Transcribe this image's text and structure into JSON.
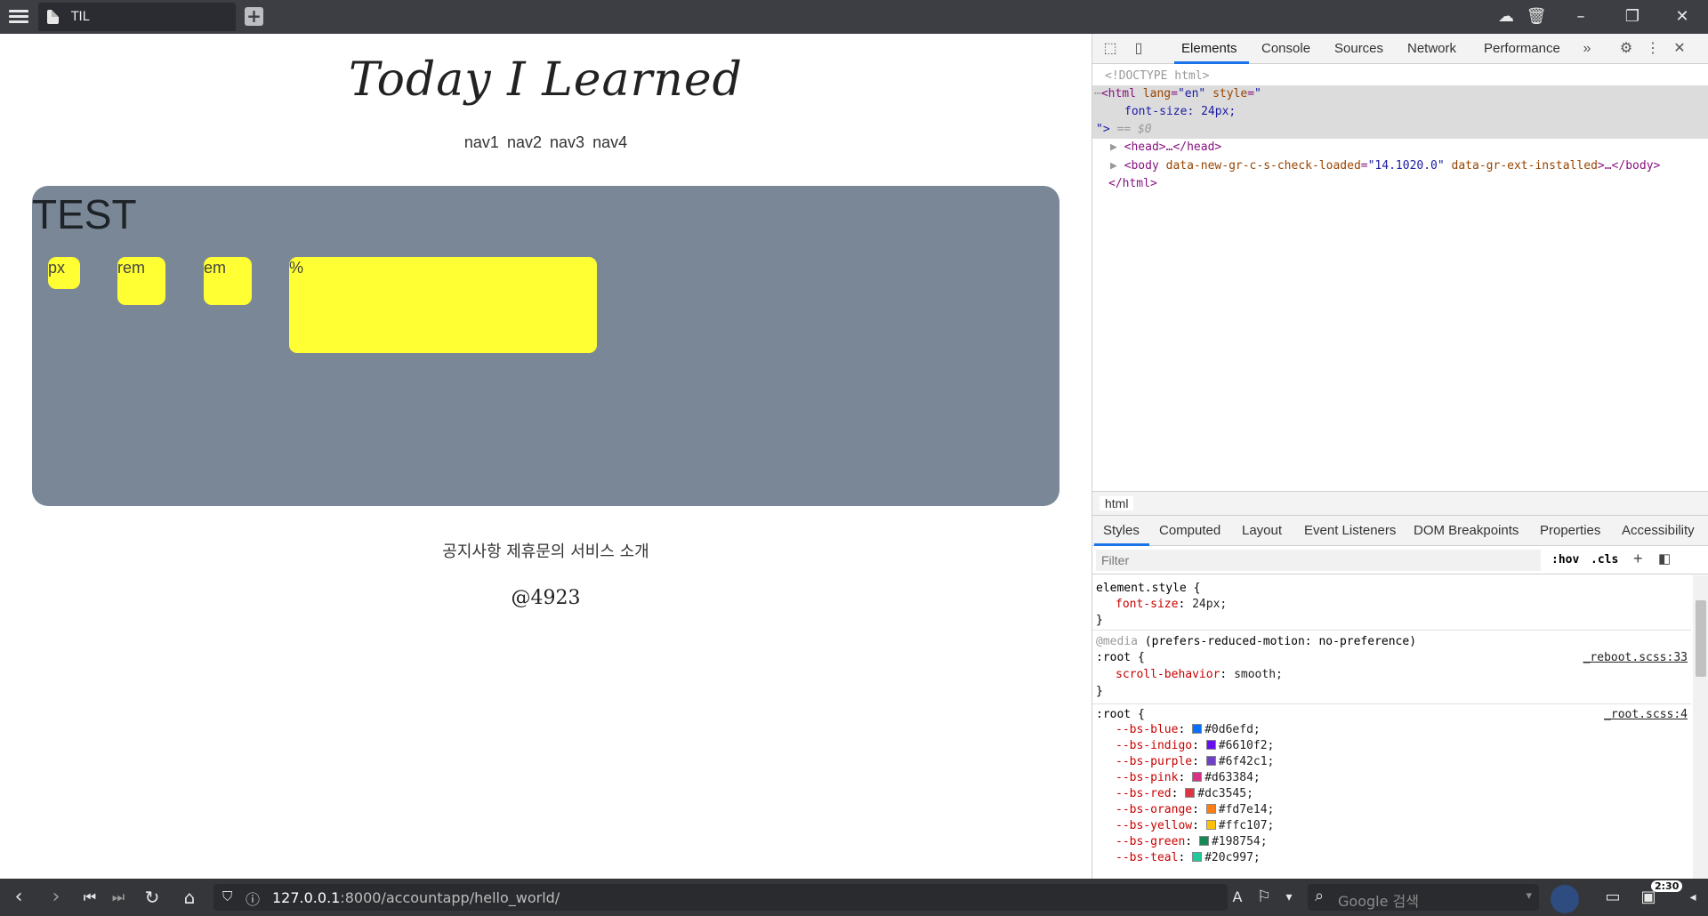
{
  "browser": {
    "tab_title": "TIL",
    "url_host": "127.0.0.1",
    "url_rest": ":8000/accountapp/hello_world/",
    "search_placeholder": "Google 검색",
    "clock": "2:30"
  },
  "page": {
    "title": "Today I Learned",
    "nav": [
      "nav1",
      "nav2",
      "nav3",
      "nav4"
    ],
    "test_heading": "TEST",
    "boxes": [
      "px",
      "rem",
      "em",
      "%"
    ],
    "footer_links": "공지사항 제휴문의 서비스 소개",
    "footer_copy": "@4923"
  },
  "devtools": {
    "tabs": [
      "Elements",
      "Console",
      "Sources",
      "Network",
      "Performance"
    ],
    "elements": {
      "doctype": "<!DOCTYPE html>",
      "html_open_tag": "<html",
      "html_attr_lang": "lang",
      "html_lang_val": "\"en\"",
      "html_attr_style": "style",
      "html_style_val": "\"",
      "style_line": "font-size: 24px;",
      "style_close": "\">",
      "eq0": "== $0",
      "head": "<head>…</head>",
      "body_open": "<body",
      "body_attr1": "data-new-gr-c-s-check-loaded",
      "body_attr1_val": "\"14.1020.0\"",
      "body_attr2": "data-gr-ext-installed",
      "body_close": ">…</body>",
      "html_close": "</html>"
    },
    "breadcrumb": "html",
    "sub_tabs": [
      "Styles",
      "Computed",
      "Layout",
      "Event Listeners",
      "DOM Breakpoints",
      "Properties",
      "Accessibility"
    ],
    "filter_placeholder": "Filter",
    "hov": ":hov",
    "cls": ".cls",
    "rules": {
      "element_style": {
        "selector": "element.style {",
        "prop": "font-size",
        "value": "24px;"
      },
      "media": {
        "at": "@media",
        "condition": "(prefers-reduced-motion: no-preference)",
        "selector": ":root {",
        "source": "_reboot.scss:33",
        "prop": "scroll-behavior",
        "value": "smooth;"
      },
      "root": {
        "selector": ":root {",
        "source": "_root.scss:4",
        "vars": [
          {
            "name": "--bs-blue",
            "value": "#0d6efd;",
            "color": "#0d6efd"
          },
          {
            "name": "--bs-indigo",
            "value": "#6610f2;",
            "color": "#6610f2"
          },
          {
            "name": "--bs-purple",
            "value": "#6f42c1;",
            "color": "#6f42c1"
          },
          {
            "name": "--bs-pink",
            "value": "#d63384;",
            "color": "#d63384"
          },
          {
            "name": "--bs-red",
            "value": "#dc3545;",
            "color": "#dc3545"
          },
          {
            "name": "--bs-orange",
            "value": "#fd7e14;",
            "color": "#fd7e14"
          },
          {
            "name": "--bs-yellow",
            "value": "#ffc107;",
            "color": "#ffc107"
          },
          {
            "name": "--bs-green",
            "value": "#198754;",
            "color": "#198754"
          },
          {
            "name": "--bs-teal",
            "value": "#20c997;",
            "color": "#20c997"
          }
        ]
      }
    }
  },
  "colors": {
    "test_box": "#798797",
    "yellow_box": "#ffff33",
    "devtools_accent": "#1a73e8"
  }
}
